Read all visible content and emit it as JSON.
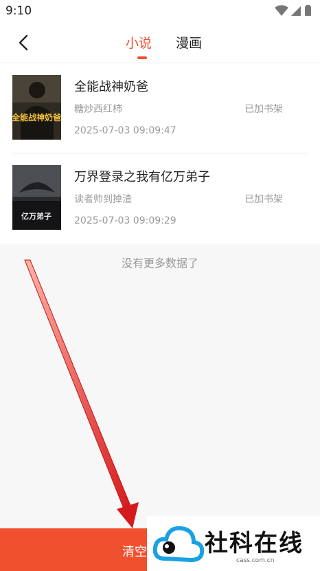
{
  "status_bar": {
    "time": "9:10"
  },
  "header": {
    "tabs": [
      {
        "label": "小说",
        "active": true
      },
      {
        "label": "漫画",
        "active": false
      }
    ]
  },
  "history": [
    {
      "title": "全能战神奶爸",
      "author": "糖炒西红柿",
      "shelf_status": "已加书架",
      "read_time": "2025-07-03 09:09:47",
      "cover_text": "全能战神奶爸"
    },
    {
      "title": "万界登录之我有亿万弟子",
      "author": "读者帅到掉渣",
      "shelf_status": "已加书架",
      "read_time": "2025-07-03 09:09:29",
      "cover_text": "亿万弟子"
    }
  ],
  "no_more_text": "没有更多数据了",
  "footer": {
    "clear_label": "清空"
  },
  "watermark": {
    "text": "社科在线",
    "domain": "cass.com.cn"
  },
  "colors": {
    "accent": "#f1502e",
    "muted": "#999999"
  }
}
